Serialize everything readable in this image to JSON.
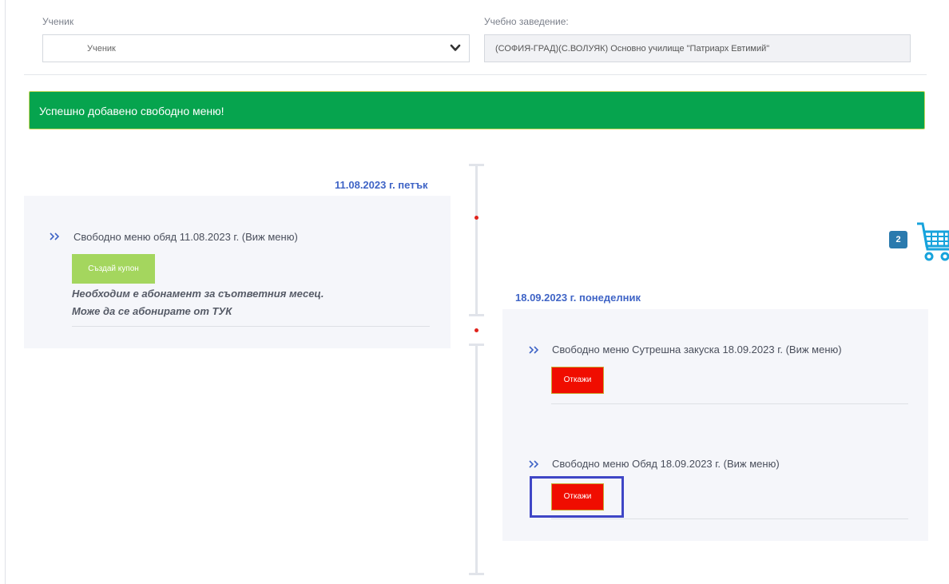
{
  "filters": {
    "student_label": "Ученик",
    "student_selected": "Ученик",
    "school_label": "Учебно заведение:",
    "school_value": "(СОФИЯ-ГРАД)(С.ВОЛУЯК) Основно училище \"Патриарх Евтимий\""
  },
  "alert": {
    "message": "Успешно добавено свободно меню!",
    "color": "#06a44e"
  },
  "timeline": {
    "left": {
      "date": "11.08.2023 г. петък",
      "items": [
        {
          "title": "Свободно меню обяд 11.08.2023 г. (Виж меню)",
          "button_label": "Създай купон",
          "note_line1": "Необходим е абонамент за съответния месец.",
          "note_line2": "Може да се абонирате от ТУК"
        }
      ]
    },
    "right": {
      "date": "18.09.2023 г. понеделник",
      "items": [
        {
          "title": "Свободно меню Сутрешна закуска 18.09.2023 г. (Виж меню)",
          "button_label": "Откажи"
        },
        {
          "title": "Свободно меню Обяд 18.09.2023 г. (Виж меню)",
          "button_label": "Откажи"
        }
      ]
    }
  },
  "cart": {
    "count": "2",
    "icon": "shopping-cart-icon"
  },
  "colors": {
    "accent_blue": "#3f64c6",
    "cancel_red": "#f00d00",
    "coupon_green": "#a4d65e",
    "cart_blue": "#2a7aae"
  }
}
